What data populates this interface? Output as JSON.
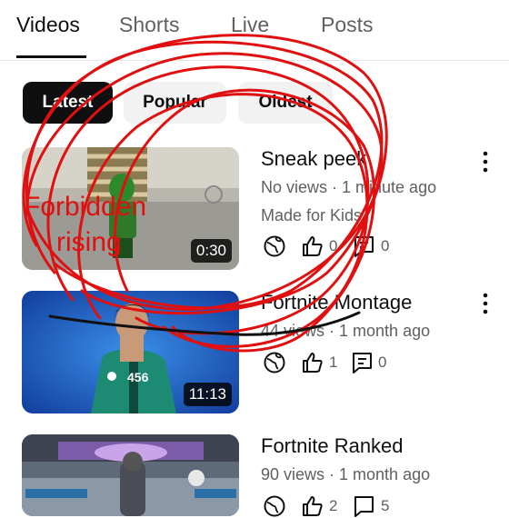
{
  "tabs": [
    "Videos",
    "Shorts",
    "Live",
    "Posts"
  ],
  "filters": [
    "Latest",
    "Popular",
    "Oldest"
  ],
  "videos": [
    {
      "title": "Sneak peek",
      "meta": "No views · 1 minute ago",
      "extra": "Made for Kids",
      "likes": "0",
      "comments": "0",
      "duration": "0:30",
      "thumb_text_1": "Forbidden",
      "thumb_text_2": "rising"
    },
    {
      "title": "Fortnite Montage",
      "meta": "44 views · 1 month ago",
      "likes": "1",
      "comments": "0",
      "duration": "11:13",
      "jersey": "456"
    },
    {
      "title": "Fortnite Ranked",
      "meta": "90 views · 1 month ago",
      "likes": "2",
      "comments": "5"
    }
  ],
  "colors": {
    "accent": "#0f0f0f",
    "secondary_text": "#606060",
    "annotation_red": "#e01010"
  }
}
